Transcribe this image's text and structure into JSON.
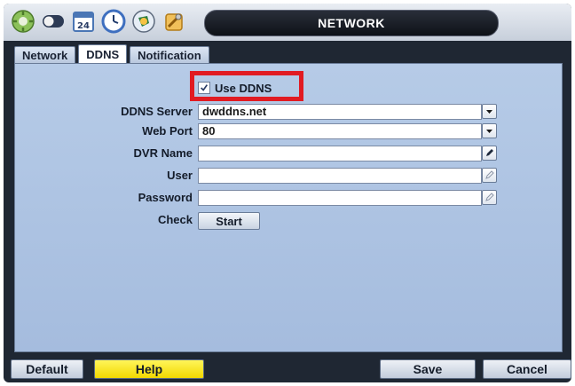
{
  "window": {
    "title": "NETWORK"
  },
  "toolbar_icons": [
    {
      "name": "settings-gear-icon",
      "color": "#7fb24a"
    },
    {
      "name": "record-toggle-icon",
      "color": "#2d3b55"
    },
    {
      "name": "calendar-icon",
      "color": "#4a76b5",
      "text": "24"
    },
    {
      "name": "clock-icon",
      "color": "#3e6fbf"
    },
    {
      "name": "network-globe-icon",
      "color": "#2e7d3e"
    },
    {
      "name": "tools-icon",
      "color": "#d79b2b"
    }
  ],
  "tabs": [
    {
      "label": "Network",
      "active": false
    },
    {
      "label": "DDNS",
      "active": true
    },
    {
      "label": "Notification",
      "active": false
    }
  ],
  "use_ddns": {
    "label": "Use DDNS",
    "checked": true
  },
  "form": {
    "ddns_server": {
      "label": "DDNS Server",
      "value": "dwddns.net"
    },
    "web_port": {
      "label": "Web Port",
      "value": "80"
    },
    "dvr_name": {
      "label": "DVR Name",
      "value": ""
    },
    "user": {
      "label": "User",
      "value": ""
    },
    "password": {
      "label": "Password",
      "value": ""
    },
    "check": {
      "label": "Check",
      "button": "Start"
    }
  },
  "buttons": {
    "default": "Default",
    "help": "Help",
    "save": "Save",
    "cancel": "Cancel"
  },
  "colors": {
    "highlight": "#e11b22",
    "help_button": "#f2d800",
    "panel": "#b0c6e4"
  }
}
